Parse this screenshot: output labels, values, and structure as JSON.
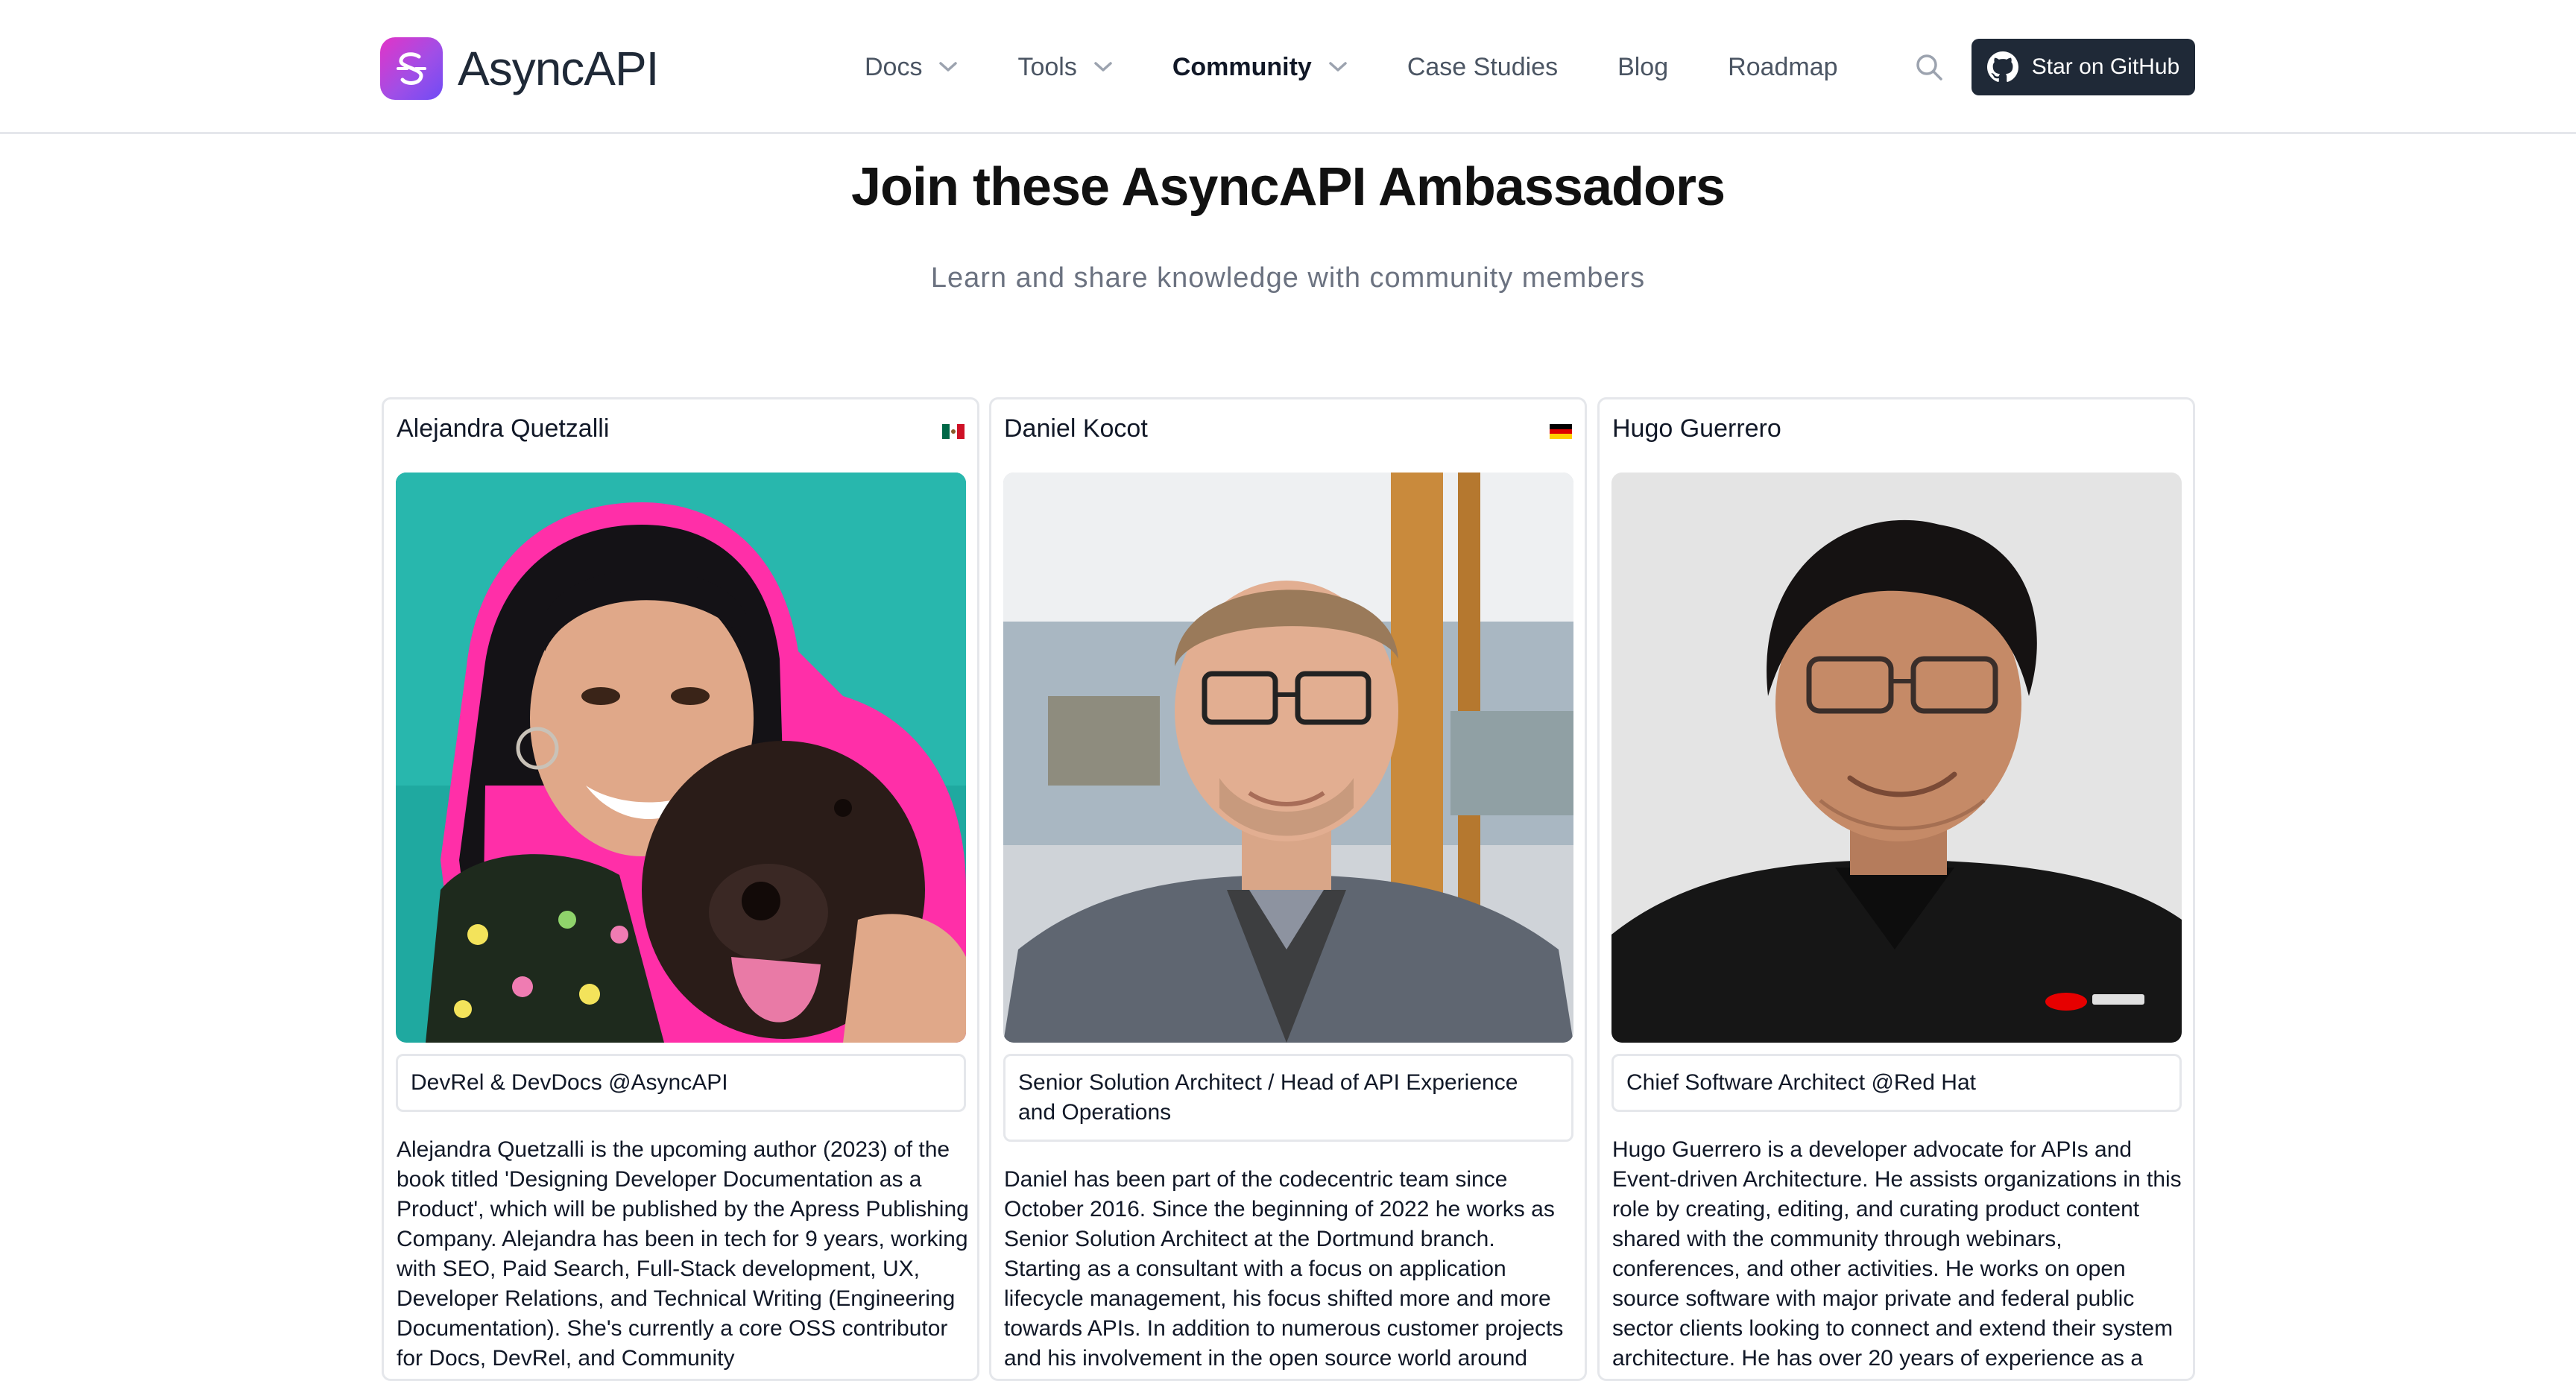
{
  "header": {
    "logo_text": "AsyncAPI",
    "nav": [
      {
        "label": "Docs",
        "dropdown": true
      },
      {
        "label": "Tools",
        "dropdown": true
      },
      {
        "label": "Community",
        "dropdown": true,
        "active": true
      },
      {
        "label": "Case Studies",
        "dropdown": false
      },
      {
        "label": "Blog",
        "dropdown": false
      },
      {
        "label": "Roadmap",
        "dropdown": false
      }
    ],
    "github_button": "Star on GitHub",
    "colors": {
      "brand_gradient_start": "#e234c7",
      "brand_gradient_end": "#6f4cf5",
      "github_button_bg": "#1f2937"
    }
  },
  "hero": {
    "title": "Join these AsyncAPI Ambassadors",
    "subtitle": "Learn and share knowledge with community members"
  },
  "ambassadors": [
    {
      "name": "Alejandra Quetzalli",
      "flag": "mexico-flag-icon",
      "role": "DevRel & DevDocs @AsyncAPI",
      "bio": "Alejandra Quetzalli is the upcoming author (2023) of the book titled 'Designing Developer Documentation as a Product', which will be published by the Apress Publishing Company. Alejandra has been in tech for 9 years, working with SEO, Paid Search, Full-Stack development, UX, Developer Relations, and Technical Writing (Engineering Documentation). She's currently a core OSS contributor for Docs, DevRel, and Community"
    },
    {
      "name": "Daniel Kocot",
      "flag": "germany-flag-icon",
      "role": "Senior Solution Architect / Head of API Experience and Operations",
      "bio": "Daniel has been part of the codecentric team since October 2016. Since the beginning of 2022 he works as Senior Solution Architect at the Dortmund branch. Starting as a consultant with a focus on application lifecycle management, his focus shifted more and more towards APIs. In addition to numerous customer projects and his involvement in the open source world around"
    },
    {
      "name": "Hugo Guerrero",
      "flag": "",
      "role": "Chief Software Architect @Red Hat",
      "bio": "Hugo Guerrero is a developer advocate for APIs and Event-driven Architecture. He assists organizations in this role by creating, editing, and curating product content shared with the community through webinars, conferences, and other activities. He works on open source software with major private and federal public sector clients looking to connect and extend their system architecture. He has over 20 years of experience as a"
    }
  ]
}
